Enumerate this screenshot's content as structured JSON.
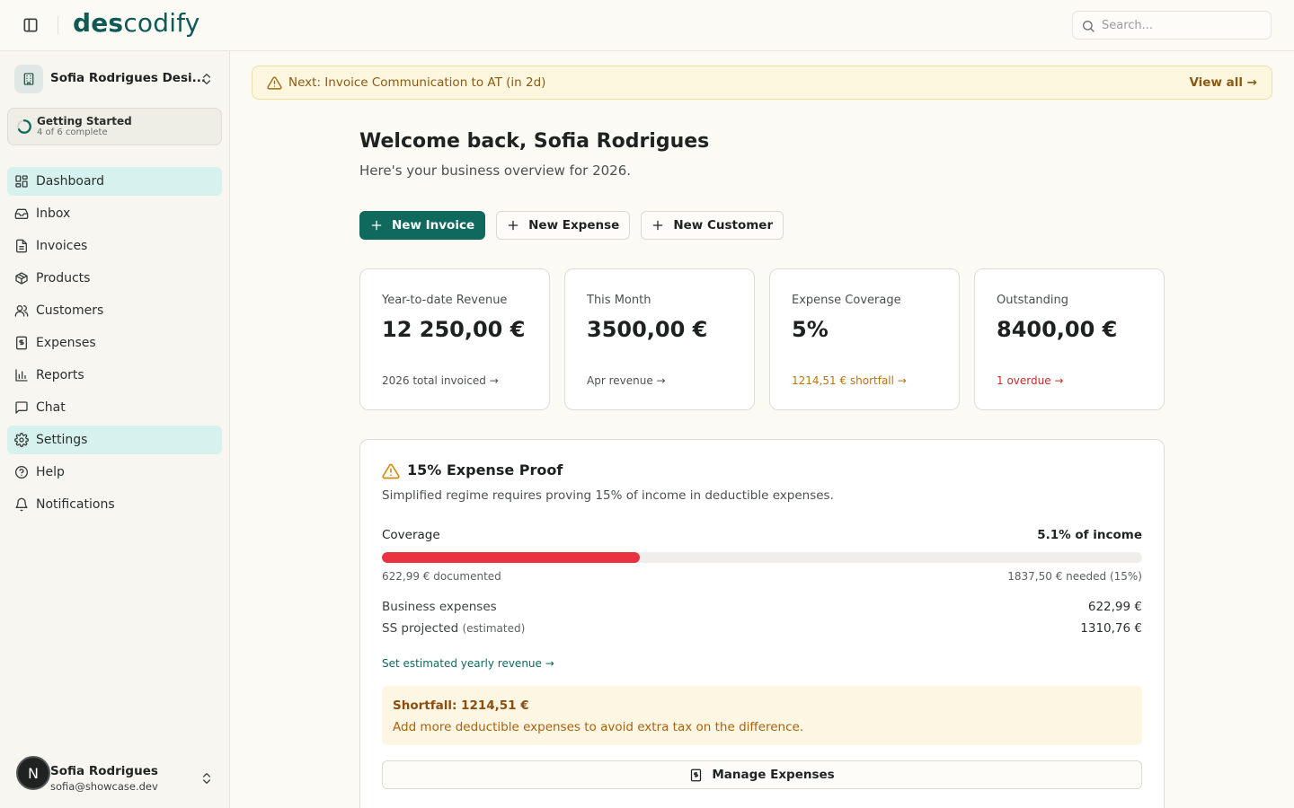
{
  "header": {
    "logo_bold": "des",
    "logo_light": "codify",
    "search_placeholder": "Search..."
  },
  "sidebar": {
    "org_name": "Sofia Rodrigues Desi...",
    "getting_started": {
      "title": "Getting Started",
      "progress": "4 of 6 complete",
      "done": 4,
      "total": 6
    },
    "items": [
      {
        "label": "Dashboard",
        "icon": "dashboard-icon",
        "active": true
      },
      {
        "label": "Inbox",
        "icon": "inbox-icon"
      },
      {
        "label": "Invoices",
        "icon": "invoice-icon"
      },
      {
        "label": "Products",
        "icon": "package-icon"
      },
      {
        "label": "Customers",
        "icon": "users-icon"
      },
      {
        "label": "Expenses",
        "icon": "receipt-icon"
      },
      {
        "label": "Reports",
        "icon": "bar-chart-icon"
      },
      {
        "label": "Chat",
        "icon": "chat-icon"
      },
      {
        "label": "Settings",
        "icon": "gear-icon",
        "highlighted": true
      },
      {
        "label": "Help",
        "icon": "help-icon"
      },
      {
        "label": "Notifications",
        "icon": "bell-icon"
      }
    ],
    "user": {
      "initial": "N",
      "name": "Sofia Rodrigues",
      "email": "sofia@showcase.dev"
    }
  },
  "notice": {
    "text": "Next: Invoice Communication to AT (in 2d)",
    "link": "View all →"
  },
  "main": {
    "welcome": "Welcome back, Sofia Rodrigues",
    "overview": "Here's your business overview for 2026.",
    "actions": {
      "new_invoice": "New Invoice",
      "new_expense": "New Expense",
      "new_customer": "New Customer"
    },
    "stats": [
      {
        "label": "Year-to-date Revenue",
        "value": "12 250,00 €",
        "note": "2026 total invoiced →",
        "tone": "neutral"
      },
      {
        "label": "This Month",
        "value": "3500,00 €",
        "note": "Apr revenue →",
        "tone": "neutral"
      },
      {
        "label": "Expense Coverage",
        "value": "5%",
        "note": "1214,51 € shortfall →",
        "tone": "warn"
      },
      {
        "label": "Outstanding",
        "value": "8400,00 €",
        "note": "1 overdue →",
        "tone": "danger"
      }
    ],
    "proof": {
      "title": "15% Expense Proof",
      "description": "Simplified regime requires proving 15% of income in deductible expenses.",
      "coverage_label": "Coverage",
      "coverage_pct": "5.1% of income",
      "coverage_fraction": 0.339,
      "documented": "622,99 € documented",
      "needed": "1837,50 € needed (15%)",
      "business_expenses_label": "Business expenses",
      "business_expenses_value": "622,99 €",
      "ss_label": "SS projected",
      "ss_note": "(estimated)",
      "ss_value": "1310,76 €",
      "set_revenue_link": "Set estimated yearly revenue →",
      "shortfall_title": "Shortfall: 1214,51 €",
      "shortfall_text": "Add more deductible expenses to avoid extra tax on the difference.",
      "manage_button": "Manage Expenses"
    }
  },
  "colors": {
    "brand": "#0e5a55",
    "primary_button": "#0f6a5d",
    "active_nav": "#d6f1ee",
    "bar_fill": "#ea3341",
    "warning_text": "#b9740f",
    "danger_text": "#c52c2c"
  }
}
